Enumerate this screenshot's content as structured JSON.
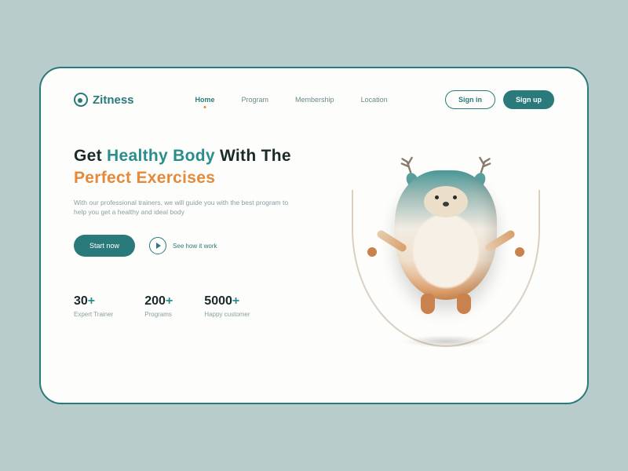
{
  "brand": "Zitness",
  "nav": {
    "items": [
      {
        "label": "Home",
        "active": true
      },
      {
        "label": "Program",
        "active": false
      },
      {
        "label": "Membership",
        "active": false
      },
      {
        "label": "Location",
        "active": false
      }
    ]
  },
  "auth": {
    "signin": "Sign in",
    "signup": "Sign up"
  },
  "hero": {
    "pre": "Get ",
    "highlight1": "Healthy Body",
    "mid": " With The ",
    "highlight2": "Perfect Exercises",
    "subtitle": "With our professional trainers, we will guide you with the best program to help you get a healthy  and ideal body"
  },
  "cta": {
    "start": "Start now",
    "how": "See how it work"
  },
  "stats": [
    {
      "num": "30",
      "plus": "+",
      "label": "Expert Trainer"
    },
    {
      "num": "200",
      "plus": "+",
      "label": "Programs"
    },
    {
      "num": "5000",
      "plus": "+",
      "label": "Happy customer"
    }
  ]
}
